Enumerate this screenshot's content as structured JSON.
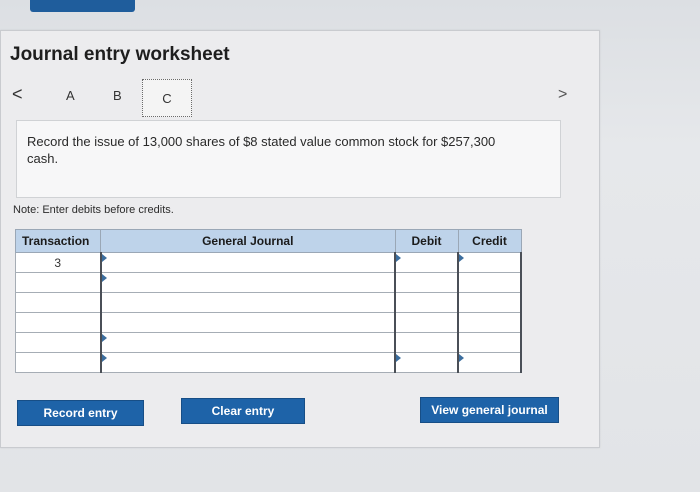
{
  "header": {
    "title": "Journal entry worksheet"
  },
  "nav": {
    "prev": "<",
    "next": ">",
    "tabs": [
      "A",
      "B",
      "C"
    ]
  },
  "prompt": {
    "text": "Record the issue of 13,000 shares of $8 stated value common stock for $257,300 cash."
  },
  "note": "Note: Enter debits before credits.",
  "table": {
    "headers": {
      "transaction": "Transaction",
      "general_journal": "General Journal",
      "debit": "Debit",
      "credit": "Credit"
    },
    "rows": [
      {
        "transaction": "3",
        "account": "",
        "debit": "",
        "credit": ""
      },
      {
        "transaction": "",
        "account": "",
        "debit": "",
        "credit": ""
      },
      {
        "transaction": "",
        "account": "",
        "debit": "",
        "credit": ""
      },
      {
        "transaction": "",
        "account": "",
        "debit": "",
        "credit": ""
      },
      {
        "transaction": "",
        "account": "",
        "debit": "",
        "credit": ""
      },
      {
        "transaction": "",
        "account": "",
        "debit": "",
        "credit": ""
      }
    ]
  },
  "buttons": {
    "record": "Record entry",
    "clear": "Clear entry",
    "view": "View general journal"
  }
}
